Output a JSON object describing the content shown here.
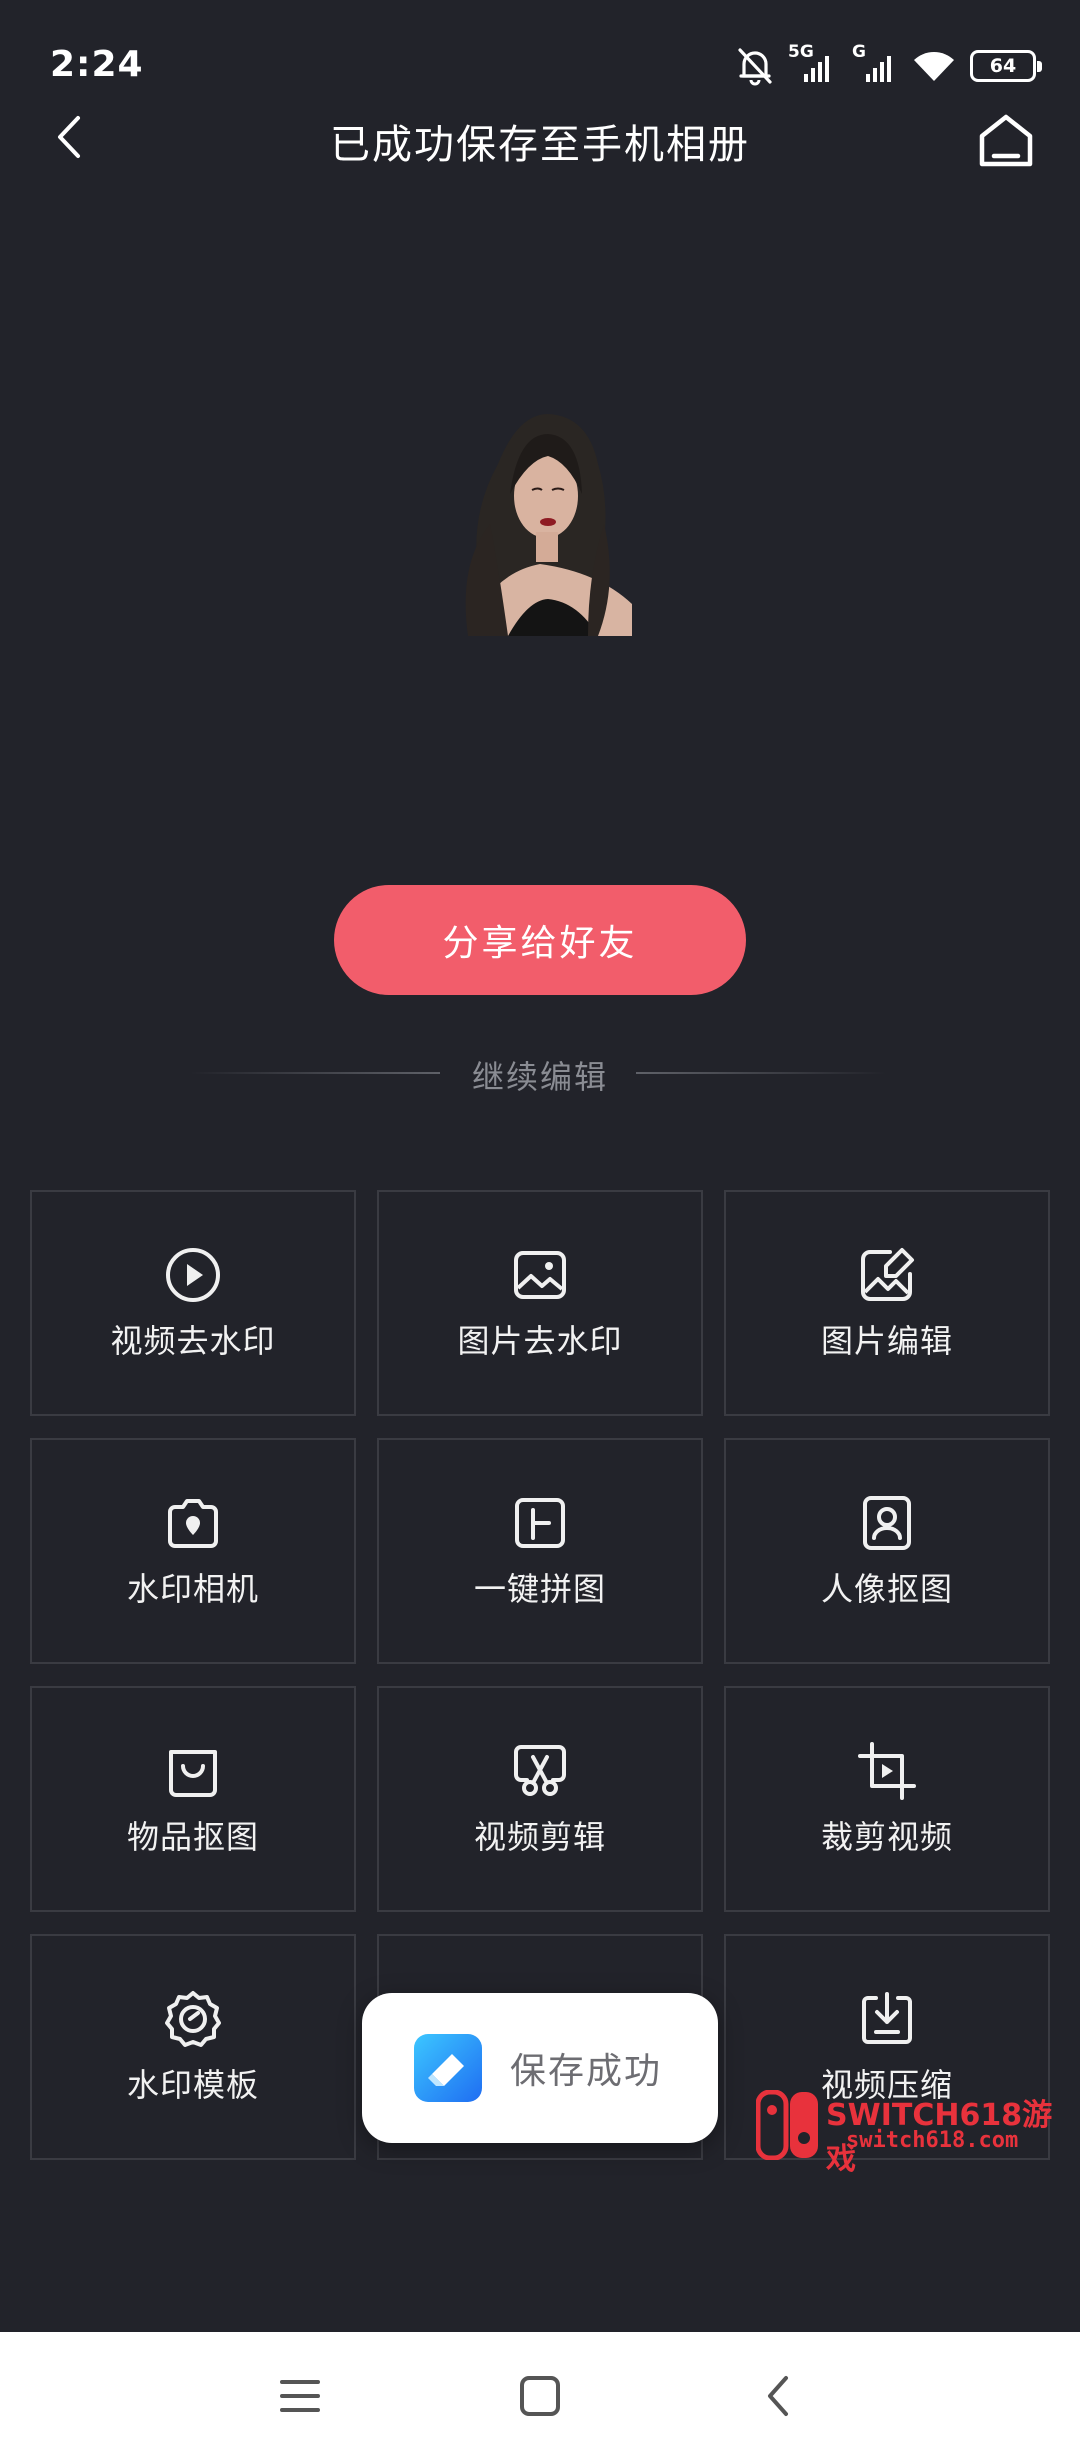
{
  "status_bar": {
    "time": "2:24",
    "network_1": "5G",
    "network_2": "G",
    "battery": "64",
    "icons": [
      "mute-bell-icon",
      "signal-5g-icon",
      "signal-g-icon",
      "wifi-icon",
      "battery-icon"
    ]
  },
  "nav": {
    "title": "已成功保存至手机相册",
    "back_icon": "chevron-left-icon",
    "home_icon": "home-icon"
  },
  "share_button": "分享给好友",
  "divider_label": "继续编辑",
  "tools": [
    {
      "label": "视频去水印",
      "icon": "play-circle-icon"
    },
    {
      "label": "图片去水印",
      "icon": "image-icon"
    },
    {
      "label": "图片编辑",
      "icon": "image-edit-icon"
    },
    {
      "label": "水印相机",
      "icon": "camera-icon"
    },
    {
      "label": "一键拼图",
      "icon": "collage-icon"
    },
    {
      "label": "人像抠图",
      "icon": "portrait-icon"
    },
    {
      "label": "物品抠图",
      "icon": "bag-icon"
    },
    {
      "label": "视频剪辑",
      "icon": "scissors-video-icon"
    },
    {
      "label": "裁剪视频",
      "icon": "crop-video-icon"
    },
    {
      "label": "水印模板",
      "icon": "gear-badge-icon"
    },
    {
      "label": "",
      "icon": ""
    },
    {
      "label": "视频压缩",
      "icon": "download-box-icon"
    }
  ],
  "toast": {
    "text": "保存成功",
    "icon": "app-logo-icon"
  },
  "watermark": {
    "line1": "SWITCH618游戏",
    "line2": "switch618.com"
  },
  "system_nav": [
    "menu-icon",
    "home-square-icon",
    "back-icon"
  ],
  "colors": {
    "background": "#22232a",
    "accent": "#f25d6b",
    "tile_border": "#3a3b42"
  }
}
